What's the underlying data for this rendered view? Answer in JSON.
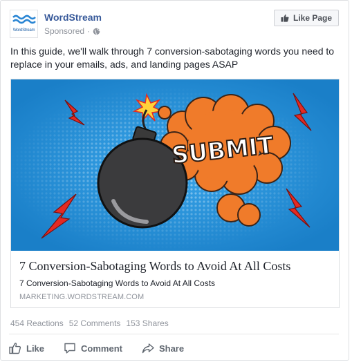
{
  "header": {
    "page_name": "WordStream",
    "avatar_text": "WordStream",
    "sponsored": "Sponsored",
    "separator": "·",
    "like_page": "Like Page"
  },
  "post": {
    "text": "In this guide, we'll walk through 7 conversion-sabotaging words you need to replace in your emails, ads, and landing pages ASAP"
  },
  "card": {
    "image_text": "SUBMIT",
    "title": "7 Conversion-Sabotaging Words to Avoid At All Costs",
    "description": "7 Conversion-Sabotaging Words to Avoid At All Costs",
    "domain": "MARKETING.WORDSTREAM.COM"
  },
  "stats": {
    "reactions": "454 Reactions",
    "comments": "52 Comments",
    "shares": "153 Shares"
  },
  "actions": {
    "like": "Like",
    "comment": "Comment",
    "share": "Share"
  },
  "colors": {
    "brand_blue": "#365899",
    "image_blue": "#1f8fd6",
    "burst_orange": "#f07b2a",
    "bolt_red": "#e42a23",
    "muted": "#90949c"
  }
}
